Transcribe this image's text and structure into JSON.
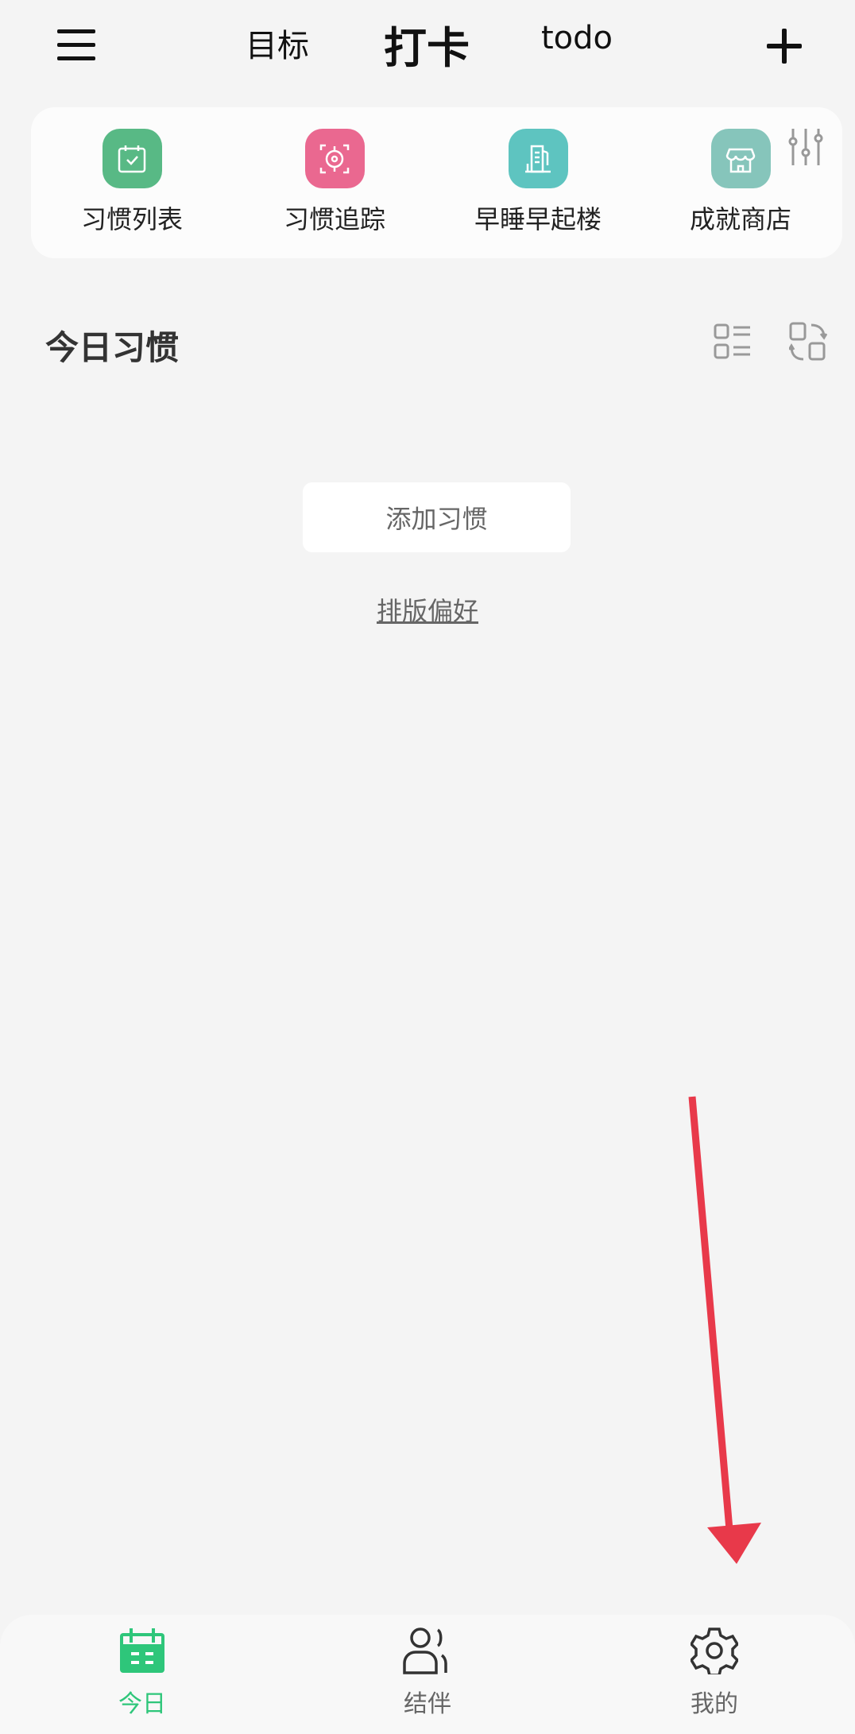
{
  "header": {
    "tabs": [
      {
        "label": "目标"
      },
      {
        "label": "打卡",
        "active": true
      },
      {
        "label": "todo"
      }
    ]
  },
  "entries": [
    {
      "label": "习惯列表",
      "icon": "calendar-check-icon",
      "color": "#58b985"
    },
    {
      "label": "习惯追踪",
      "icon": "target-icon",
      "color": "#ea6890"
    },
    {
      "label": "早睡早起楼",
      "icon": "building-icon",
      "color": "#5ec4c0"
    },
    {
      "label": "成就商店",
      "icon": "store-icon",
      "color": "#86c5bb"
    }
  ],
  "section": {
    "title": "今日习惯"
  },
  "main": {
    "add_button": "添加习惯",
    "layout_pref": "排版偏好"
  },
  "nav": {
    "items": [
      {
        "label": "今日",
        "active": true
      },
      {
        "label": "结伴"
      },
      {
        "label": "我的"
      }
    ]
  },
  "colors": {
    "accent": "#2ec67a",
    "annotation_arrow": "#e8394a"
  }
}
